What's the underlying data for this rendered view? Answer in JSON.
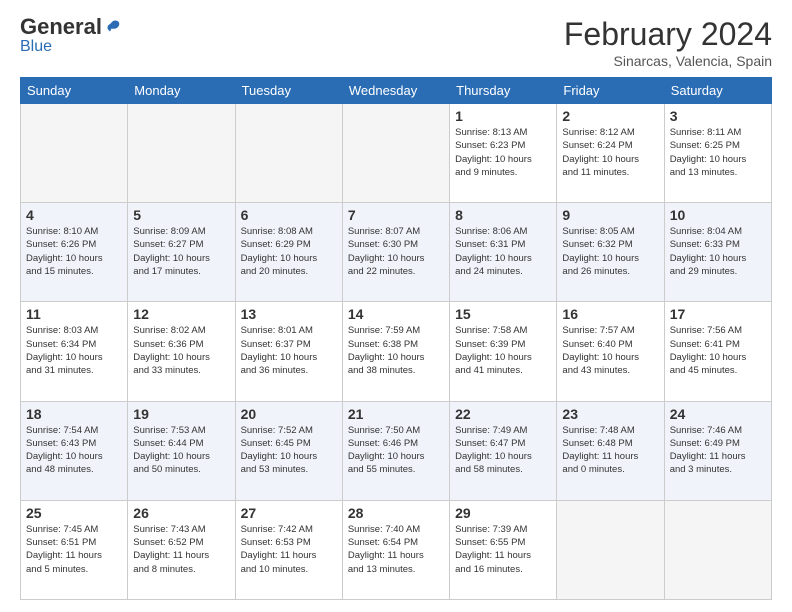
{
  "logo": {
    "general": "General",
    "blue": "Blue"
  },
  "header": {
    "month": "February 2024",
    "location": "Sinarcas, Valencia, Spain"
  },
  "days_of_week": [
    "Sunday",
    "Monday",
    "Tuesday",
    "Wednesday",
    "Thursday",
    "Friday",
    "Saturday"
  ],
  "weeks": [
    [
      {
        "day": "",
        "info": ""
      },
      {
        "day": "",
        "info": ""
      },
      {
        "day": "",
        "info": ""
      },
      {
        "day": "",
        "info": ""
      },
      {
        "day": "1",
        "info": "Sunrise: 8:13 AM\nSunset: 6:23 PM\nDaylight: 10 hours\nand 9 minutes."
      },
      {
        "day": "2",
        "info": "Sunrise: 8:12 AM\nSunset: 6:24 PM\nDaylight: 10 hours\nand 11 minutes."
      },
      {
        "day": "3",
        "info": "Sunrise: 8:11 AM\nSunset: 6:25 PM\nDaylight: 10 hours\nand 13 minutes."
      }
    ],
    [
      {
        "day": "4",
        "info": "Sunrise: 8:10 AM\nSunset: 6:26 PM\nDaylight: 10 hours\nand 15 minutes."
      },
      {
        "day": "5",
        "info": "Sunrise: 8:09 AM\nSunset: 6:27 PM\nDaylight: 10 hours\nand 17 minutes."
      },
      {
        "day": "6",
        "info": "Sunrise: 8:08 AM\nSunset: 6:29 PM\nDaylight: 10 hours\nand 20 minutes."
      },
      {
        "day": "7",
        "info": "Sunrise: 8:07 AM\nSunset: 6:30 PM\nDaylight: 10 hours\nand 22 minutes."
      },
      {
        "day": "8",
        "info": "Sunrise: 8:06 AM\nSunset: 6:31 PM\nDaylight: 10 hours\nand 24 minutes."
      },
      {
        "day": "9",
        "info": "Sunrise: 8:05 AM\nSunset: 6:32 PM\nDaylight: 10 hours\nand 26 minutes."
      },
      {
        "day": "10",
        "info": "Sunrise: 8:04 AM\nSunset: 6:33 PM\nDaylight: 10 hours\nand 29 minutes."
      }
    ],
    [
      {
        "day": "11",
        "info": "Sunrise: 8:03 AM\nSunset: 6:34 PM\nDaylight: 10 hours\nand 31 minutes."
      },
      {
        "day": "12",
        "info": "Sunrise: 8:02 AM\nSunset: 6:36 PM\nDaylight: 10 hours\nand 33 minutes."
      },
      {
        "day": "13",
        "info": "Sunrise: 8:01 AM\nSunset: 6:37 PM\nDaylight: 10 hours\nand 36 minutes."
      },
      {
        "day": "14",
        "info": "Sunrise: 7:59 AM\nSunset: 6:38 PM\nDaylight: 10 hours\nand 38 minutes."
      },
      {
        "day": "15",
        "info": "Sunrise: 7:58 AM\nSunset: 6:39 PM\nDaylight: 10 hours\nand 41 minutes."
      },
      {
        "day": "16",
        "info": "Sunrise: 7:57 AM\nSunset: 6:40 PM\nDaylight: 10 hours\nand 43 minutes."
      },
      {
        "day": "17",
        "info": "Sunrise: 7:56 AM\nSunset: 6:41 PM\nDaylight: 10 hours\nand 45 minutes."
      }
    ],
    [
      {
        "day": "18",
        "info": "Sunrise: 7:54 AM\nSunset: 6:43 PM\nDaylight: 10 hours\nand 48 minutes."
      },
      {
        "day": "19",
        "info": "Sunrise: 7:53 AM\nSunset: 6:44 PM\nDaylight: 10 hours\nand 50 minutes."
      },
      {
        "day": "20",
        "info": "Sunrise: 7:52 AM\nSunset: 6:45 PM\nDaylight: 10 hours\nand 53 minutes."
      },
      {
        "day": "21",
        "info": "Sunrise: 7:50 AM\nSunset: 6:46 PM\nDaylight: 10 hours\nand 55 minutes."
      },
      {
        "day": "22",
        "info": "Sunrise: 7:49 AM\nSunset: 6:47 PM\nDaylight: 10 hours\nand 58 minutes."
      },
      {
        "day": "23",
        "info": "Sunrise: 7:48 AM\nSunset: 6:48 PM\nDaylight: 11 hours\nand 0 minutes."
      },
      {
        "day": "24",
        "info": "Sunrise: 7:46 AM\nSunset: 6:49 PM\nDaylight: 11 hours\nand 3 minutes."
      }
    ],
    [
      {
        "day": "25",
        "info": "Sunrise: 7:45 AM\nSunset: 6:51 PM\nDaylight: 11 hours\nand 5 minutes."
      },
      {
        "day": "26",
        "info": "Sunrise: 7:43 AM\nSunset: 6:52 PM\nDaylight: 11 hours\nand 8 minutes."
      },
      {
        "day": "27",
        "info": "Sunrise: 7:42 AM\nSunset: 6:53 PM\nDaylight: 11 hours\nand 10 minutes."
      },
      {
        "day": "28",
        "info": "Sunrise: 7:40 AM\nSunset: 6:54 PM\nDaylight: 11 hours\nand 13 minutes."
      },
      {
        "day": "29",
        "info": "Sunrise: 7:39 AM\nSunset: 6:55 PM\nDaylight: 11 hours\nand 16 minutes."
      },
      {
        "day": "",
        "info": ""
      },
      {
        "day": "",
        "info": ""
      }
    ]
  ]
}
